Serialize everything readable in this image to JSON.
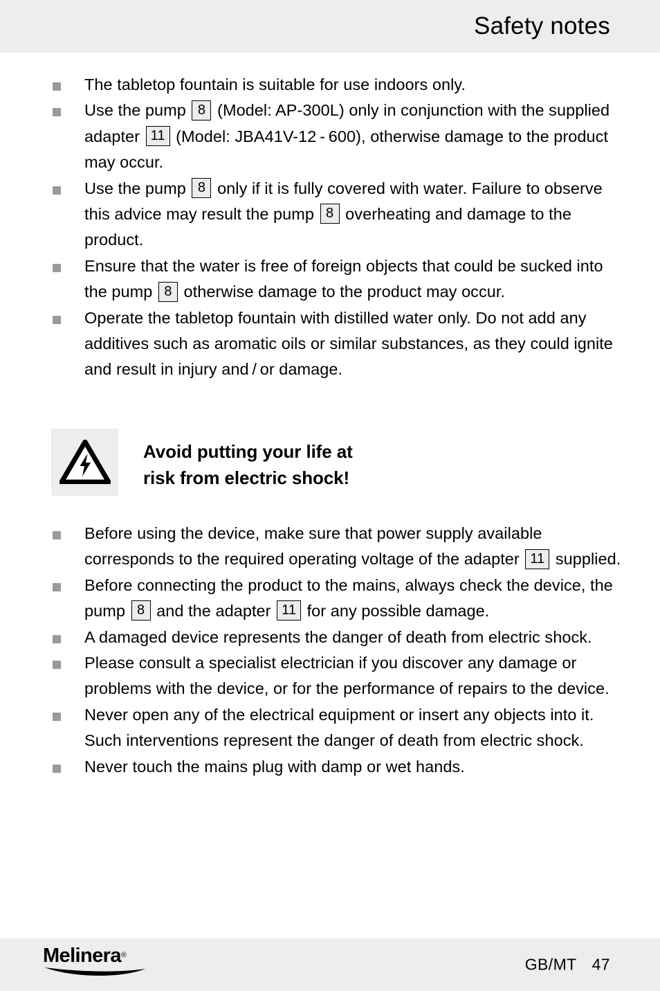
{
  "header": {
    "title": "Safety notes"
  },
  "colors": {
    "band_gray": "#ededec",
    "bullet_gray": "#9a9a9d",
    "ref_box_fill": "#ececec",
    "text": "#000000"
  },
  "content": {
    "list_one": [
      {
        "id": "bullet-indoors-only",
        "segments": [
          {
            "type": "text",
            "value": "The tabletop fountain is suitable for use indoors only."
          }
        ]
      },
      {
        "id": "bullet-pump-adapter-models",
        "segments": [
          {
            "type": "text",
            "value": "Use the pump "
          },
          {
            "type": "ref",
            "value": "8"
          },
          {
            "type": "text",
            "value": " (Model: AP-300L) only in conjunction with the supplied adapter "
          },
          {
            "type": "ref",
            "value": "11"
          },
          {
            "type": "text",
            "value": " (Model: JBA41V-12 - 600), otherwise damage to the product may occur."
          }
        ]
      },
      {
        "id": "bullet-pump-covered-water",
        "segments": [
          {
            "type": "text",
            "value": "Use the pump "
          },
          {
            "type": "ref",
            "value": "8"
          },
          {
            "type": "text",
            "value": " only if it is fully covered with water. Failure to observe this advice may result the pump "
          },
          {
            "type": "ref",
            "value": "8"
          },
          {
            "type": "text",
            "value": " overheating and damage to the product."
          }
        ]
      },
      {
        "id": "bullet-water-free-of-objects",
        "segments": [
          {
            "type": "text",
            "value": "Ensure that the water is free of foreign objects that could be sucked into the pump "
          },
          {
            "type": "ref",
            "value": "8"
          },
          {
            "type": "text",
            "value": " otherwise damage to the product may occur."
          }
        ]
      },
      {
        "id": "bullet-distilled-water",
        "segments": [
          {
            "type": "text",
            "value": "Operate the tabletop fountain with distilled water only. Do not add any additives such as aromatic oils or similar substances, as they could ignite and result in injury and / or damage."
          }
        ]
      }
    ],
    "warning": {
      "icon_name": "electric-shock-warning-icon",
      "heading_line1": "Avoid putting your life at",
      "heading_line2": "risk from electric shock!"
    },
    "list_two": [
      {
        "id": "bullet-power-supply-voltage",
        "segments": [
          {
            "type": "text",
            "value": "Before using the device, make sure that power supply available corresponds to the required operating voltage of the adapter "
          },
          {
            "type": "ref",
            "value": "11"
          },
          {
            "type": "text",
            "value": " supplied."
          }
        ]
      },
      {
        "id": "bullet-check-before-mains",
        "segments": [
          {
            "type": "text",
            "value": "Before connecting the product to the mains, always check the device, the pump "
          },
          {
            "type": "ref",
            "value": "8"
          },
          {
            "type": "text",
            "value": " and the adapter "
          },
          {
            "type": "ref",
            "value": "11"
          },
          {
            "type": "text",
            "value": " for any possible damage."
          }
        ]
      },
      {
        "id": "bullet-damaged-device-danger",
        "segments": [
          {
            "type": "text",
            "value": "A damaged device represents the danger of death from electric shock."
          }
        ]
      },
      {
        "id": "bullet-consult-electrician",
        "segments": [
          {
            "type": "text",
            "value": "Please consult a specialist electrician if you discover any damage or problems with the device, or for the performance of repairs to the device."
          }
        ]
      },
      {
        "id": "bullet-never-open-equipment",
        "segments": [
          {
            "type": "text",
            "value": "Never open any of the electrical equipment or insert any objects into it. Such interventions represent the danger of death from electric shock."
          }
        ]
      },
      {
        "id": "bullet-never-touch-plug",
        "segments": [
          {
            "type": "text",
            "value": "Never touch the mains plug with damp or wet hands."
          }
        ]
      }
    ]
  },
  "footer": {
    "brand": "Melinera",
    "brand_mark": "®",
    "locale": "GB/MT",
    "page_number": "47"
  }
}
